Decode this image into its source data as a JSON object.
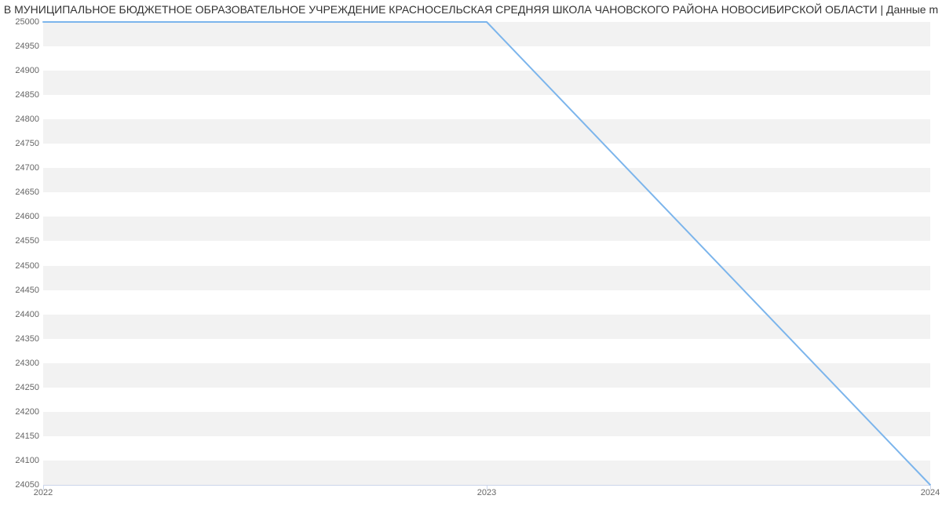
{
  "title": "В МУНИЦИПАЛЬНОЕ БЮДЖЕТНОЕ ОБРАЗОВАТЕЛЬНОЕ УЧРЕЖДЕНИЕ КРАСНОСЕЛЬСКАЯ СРЕДНЯЯ ШКОЛА ЧАНОВСКОГО РАЙОНА НОВОСИБИРСКОЙ ОБЛАСТИ | Данные m",
  "chart_data": {
    "type": "line",
    "x": [
      2022,
      2023,
      2024
    ],
    "values": [
      25000,
      25000,
      24050
    ],
    "xlabel": "",
    "ylabel": "",
    "ylim": [
      24050,
      25000
    ],
    "xlim": [
      2022,
      2024
    ],
    "y_ticks": [
      24050,
      24100,
      24150,
      24200,
      24250,
      24300,
      24350,
      24400,
      24450,
      24500,
      24550,
      24600,
      24650,
      24700,
      24750,
      24800,
      24850,
      24900,
      24950,
      25000
    ],
    "x_ticks": [
      2022,
      2023,
      2024
    ],
    "line_color": "#7cb5ec"
  }
}
